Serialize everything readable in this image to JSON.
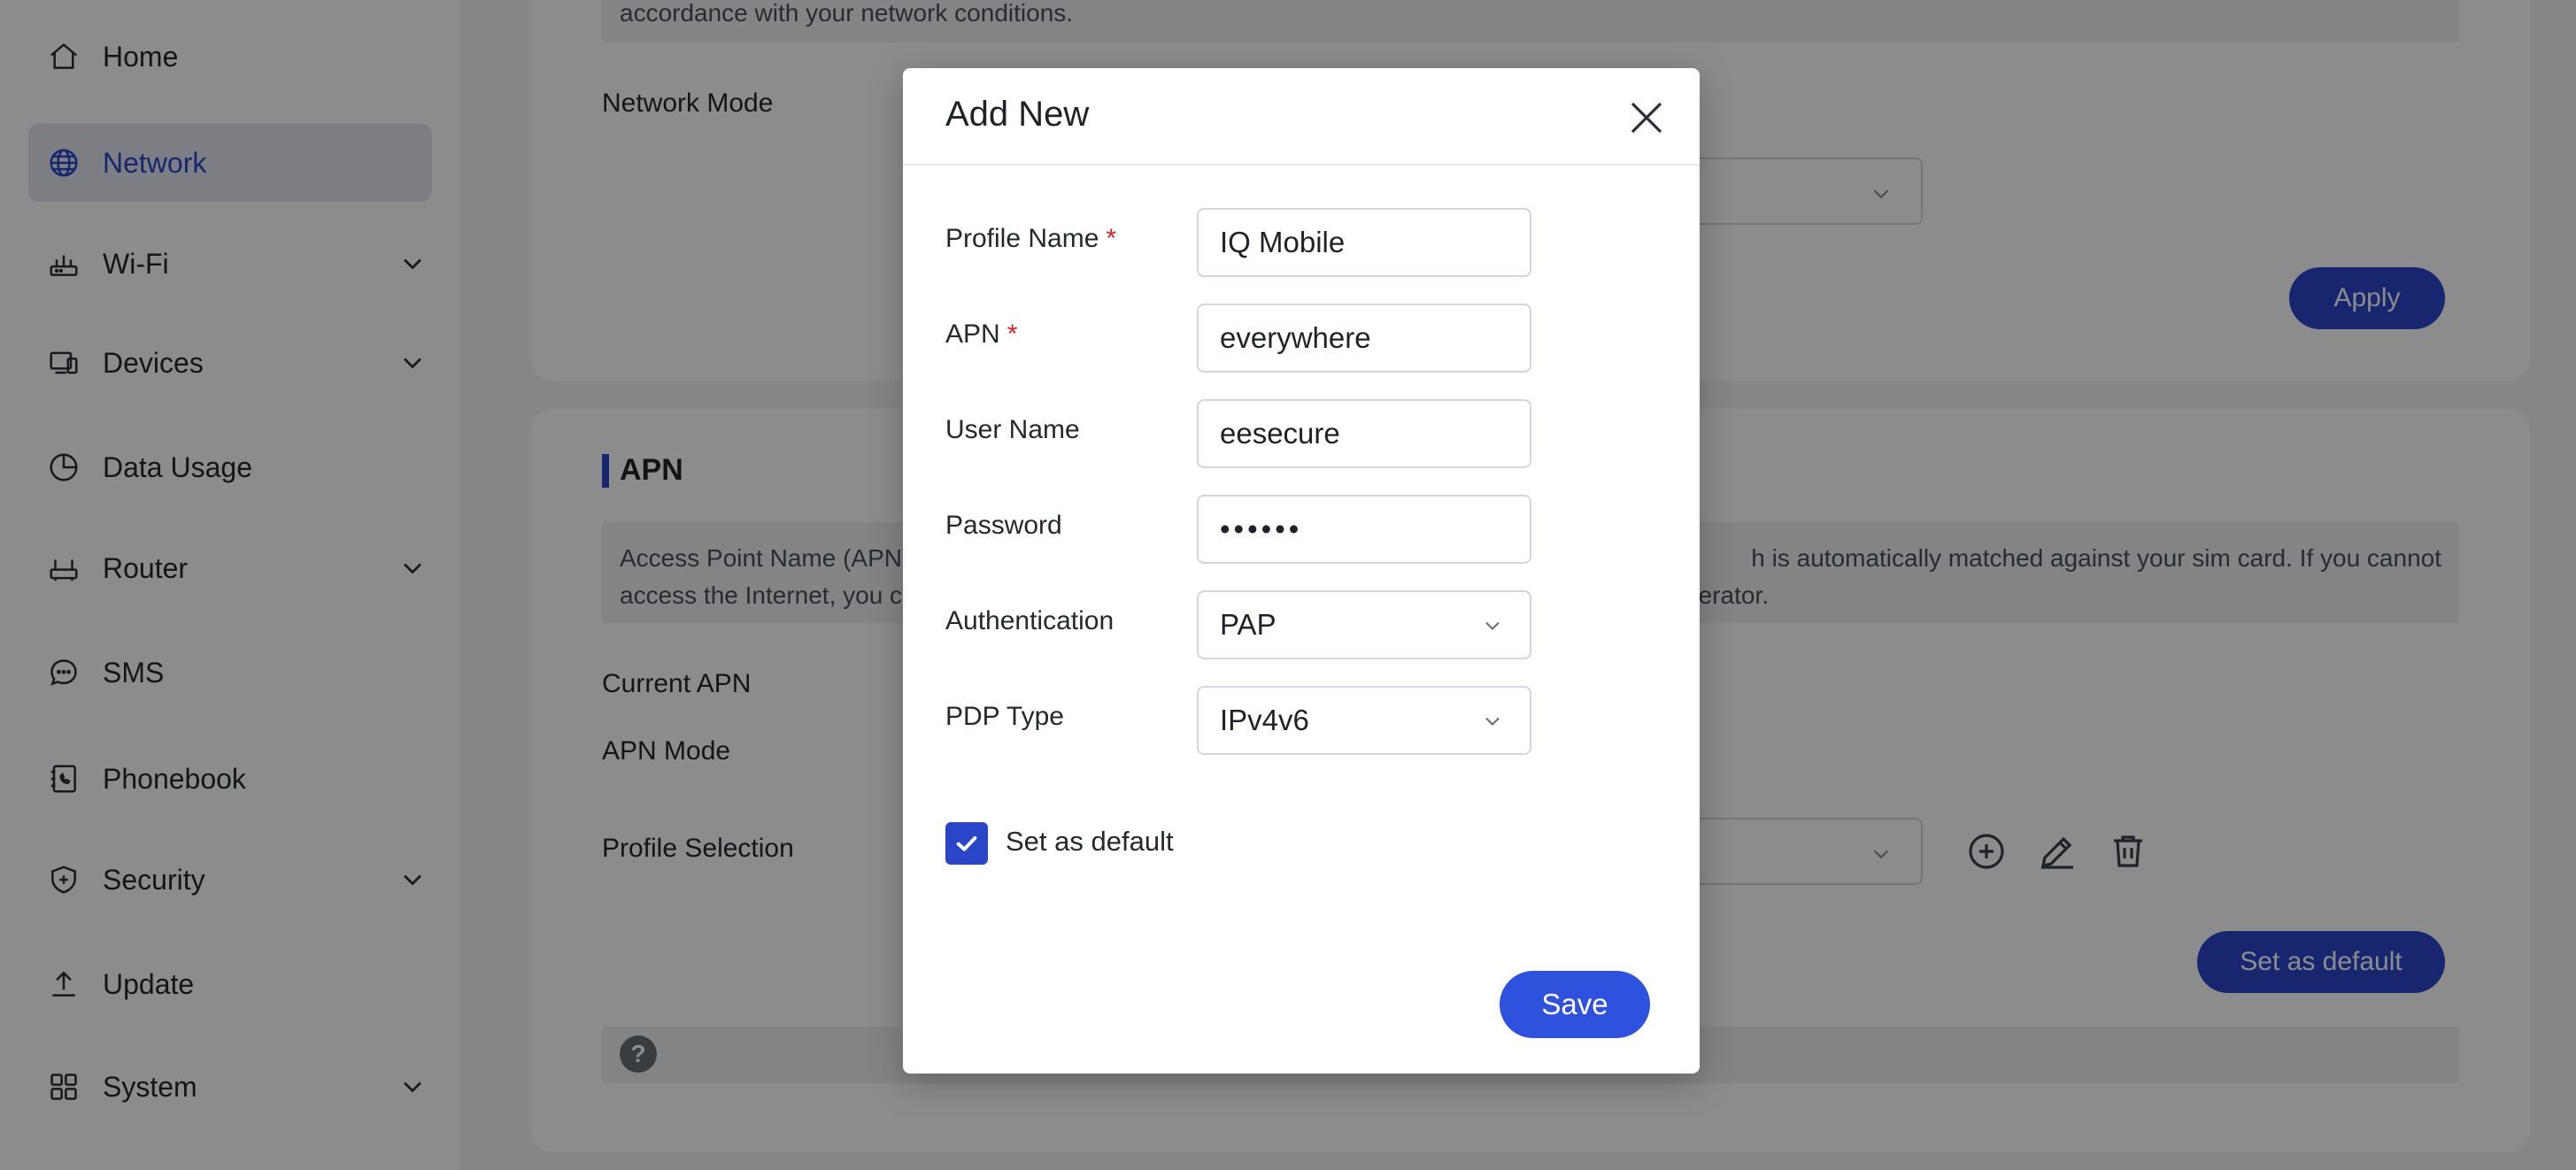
{
  "sidebar": {
    "items": [
      {
        "label": "Home",
        "icon": "home-icon",
        "expandable": false
      },
      {
        "label": "Network",
        "icon": "globe-icon",
        "expandable": false,
        "active": true
      },
      {
        "label": "Wi-Fi",
        "icon": "router-icon",
        "expandable": true
      },
      {
        "label": "Devices",
        "icon": "devices-icon",
        "expandable": true
      },
      {
        "label": "Data Usage",
        "icon": "pie-chart-icon",
        "expandable": false
      },
      {
        "label": "Router",
        "icon": "router-box-icon",
        "expandable": true
      },
      {
        "label": "SMS",
        "icon": "chat-icon",
        "expandable": false
      },
      {
        "label": "Phonebook",
        "icon": "phonebook-icon",
        "expandable": false
      },
      {
        "label": "Security",
        "icon": "shield-icon",
        "expandable": true
      },
      {
        "label": "Update",
        "icon": "upload-icon",
        "expandable": false
      },
      {
        "label": "System",
        "icon": "grid-icon",
        "expandable": true
      }
    ]
  },
  "network_card": {
    "info_text": "accordance with your network conditions.",
    "network_mode_label": "Network Mode",
    "apply_label": "Apply"
  },
  "apn_card": {
    "title": "APN",
    "info_line1_left": "Access Point Name (APN",
    "info_line1_right": "h is automatically matched against your sim card. If you cannot",
    "info_line2_left": "access the Internet, you c",
    "info_line2_right": "perator.",
    "current_apn_label": "Current APN",
    "apn_mode_label": "APN Mode",
    "profile_selection_label": "Profile Selection",
    "set_default_label": "Set as default",
    "help_glyph": "?"
  },
  "modal": {
    "title": "Add New",
    "fields": {
      "profile_name": {
        "label": "Profile Name",
        "required": "*",
        "value": "IQ Mobile"
      },
      "apn": {
        "label": "APN",
        "required": "*",
        "value": "everywhere"
      },
      "user_name": {
        "label": "User Name",
        "value": "eesecure"
      },
      "password": {
        "label": "Password",
        "value": "secret"
      },
      "authentication": {
        "label": "Authentication",
        "value": "PAP"
      },
      "pdp_type": {
        "label": "PDP Type",
        "value": "IPv4v6"
      }
    },
    "set_default": {
      "label": "Set as default",
      "checked": true
    },
    "save_label": "Save"
  },
  "colors": {
    "accent": "#2a46c8",
    "save_button": "#2f52de",
    "required": "#d3242c",
    "overlay": "rgba(0,0,0,0.45)"
  }
}
